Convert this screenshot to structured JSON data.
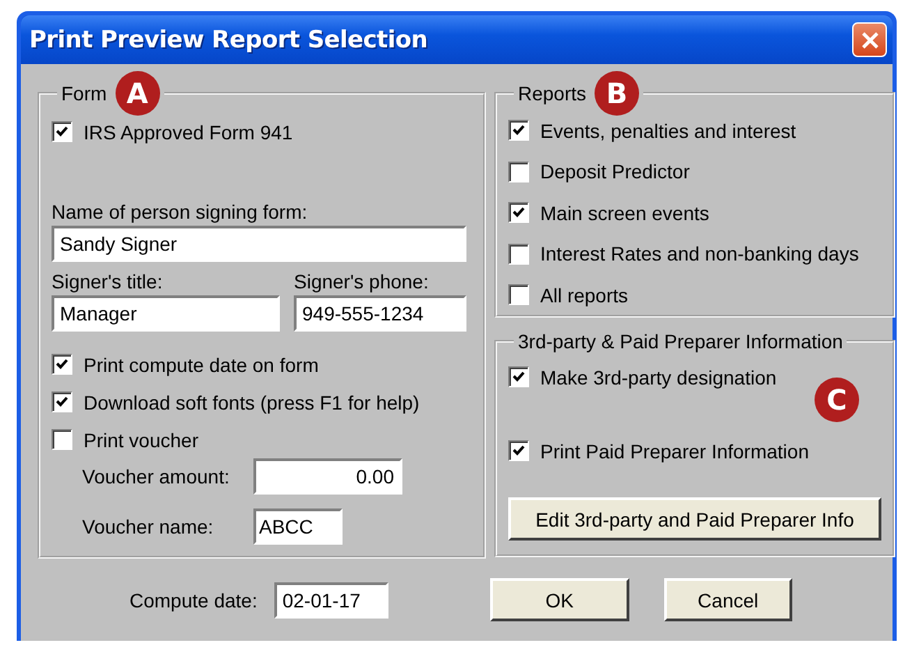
{
  "window": {
    "title": "Print Preview Report Selection"
  },
  "form_group": {
    "title": "Form",
    "callout": "A",
    "main_option": {
      "label": "IRS Approved Form 941",
      "checked": true
    },
    "signer_name": {
      "label": "Name of person signing form:",
      "value": "Sandy Signer"
    },
    "signer_title": {
      "label": "Signer's title:",
      "value": "Manager"
    },
    "signer_phone": {
      "label": "Signer's phone:",
      "value": "949-555-1234"
    },
    "print_options": [
      {
        "label": "Print compute date on form",
        "checked": true
      },
      {
        "label": "Download soft fonts (press F1 for help)",
        "checked": true
      },
      {
        "label": "Print voucher",
        "checked": false
      }
    ],
    "voucher_amount": {
      "label": "Voucher amount:",
      "value": "0.00"
    },
    "voucher_name": {
      "label": "Voucher name:",
      "value": "ABCC"
    }
  },
  "reports_group": {
    "title": "Reports",
    "callout": "B",
    "options": [
      {
        "label": "Events, penalties and interest",
        "checked": true
      },
      {
        "label": "Deposit Predictor",
        "checked": false
      },
      {
        "label": "Main screen events",
        "checked": true
      },
      {
        "label": "Interest Rates and non-banking days",
        "checked": false
      },
      {
        "label": "All reports",
        "checked": false
      }
    ]
  },
  "preparer_group": {
    "title": "3rd-party & Paid Preparer Information",
    "callout": "C",
    "options": [
      {
        "label": "Make 3rd-party designation",
        "checked": true
      },
      {
        "label": "Print Paid Preparer Information",
        "checked": true
      }
    ],
    "button": "Edit 3rd-party and Paid Preparer Info"
  },
  "compute_date": {
    "label": "Compute date:",
    "value": "02-01-17"
  },
  "buttons": [
    "OK",
    "Cancel"
  ]
}
